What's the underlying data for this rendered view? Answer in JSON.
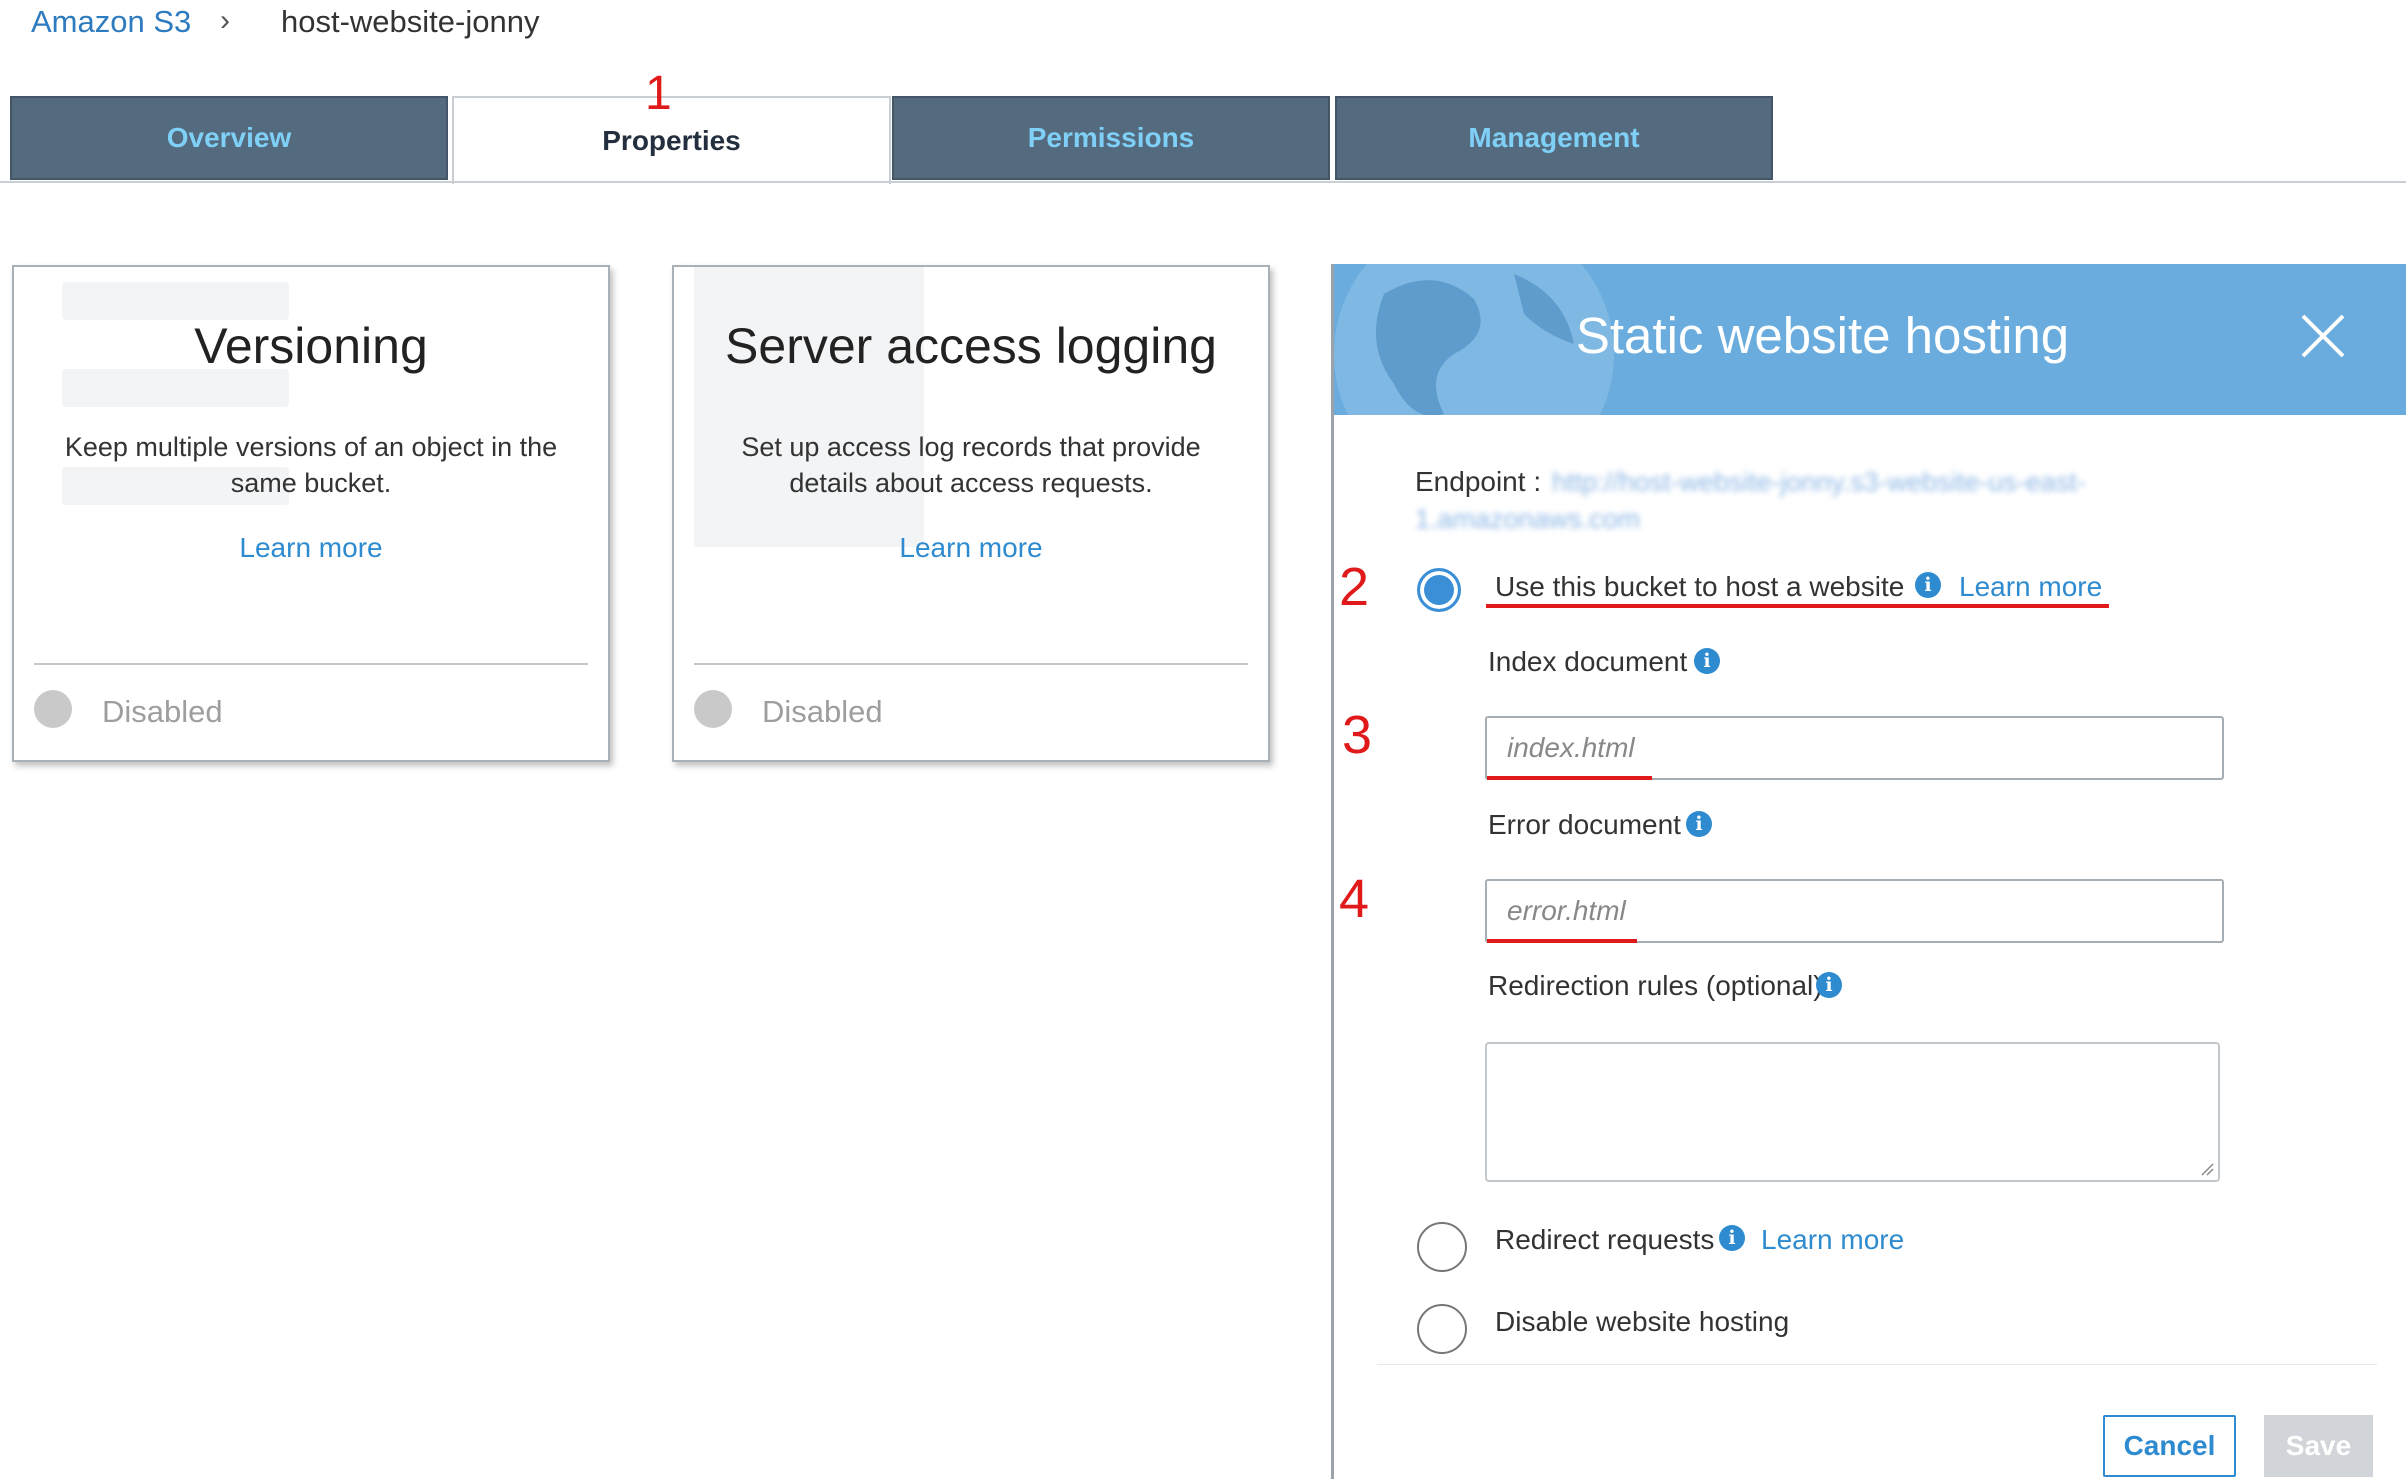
{
  "breadcrumb": {
    "root": "Amazon S3",
    "separator": "›",
    "current": "host-website-jonny"
  },
  "tabs": [
    {
      "label": "Overview"
    },
    {
      "label": "Properties"
    },
    {
      "label": "Permissions"
    },
    {
      "label": "Management"
    }
  ],
  "annotations": {
    "a1": "1",
    "a2": "2",
    "a3": "3",
    "a4": "4"
  },
  "cards": [
    {
      "title": "Versioning",
      "description": "Keep multiple versions of an object in the same bucket.",
      "link": "Learn more",
      "status": "Disabled"
    },
    {
      "title": "Server access logging",
      "description": "Set up access log records that provide details about access requests.",
      "link": "Learn more",
      "status": "Disabled"
    }
  ],
  "panel": {
    "title": "Static website hosting",
    "endpoint_label": "Endpoint :",
    "endpoint_value_line1": "http://host-website-jonny.s3-website-us-east-",
    "endpoint_value_line2": "1.amazonaws.com",
    "option_host": "Use this bucket to host a website",
    "option_host_link": "Learn more",
    "index_label": "Index document",
    "index_placeholder": "index.html",
    "error_label": "Error document",
    "error_placeholder": "error.html",
    "redirect_rules_label": "Redirection rules (optional)",
    "option_redirect": "Redirect requests",
    "option_redirect_link": "Learn more",
    "option_disable": "Disable website hosting",
    "cancel": "Cancel",
    "save": "Save"
  },
  "colors": {
    "accent": "#2e8bd0",
    "tab_bg": "#546b7f",
    "header_bg": "#69acdd",
    "annotation": "#e01a1a"
  }
}
